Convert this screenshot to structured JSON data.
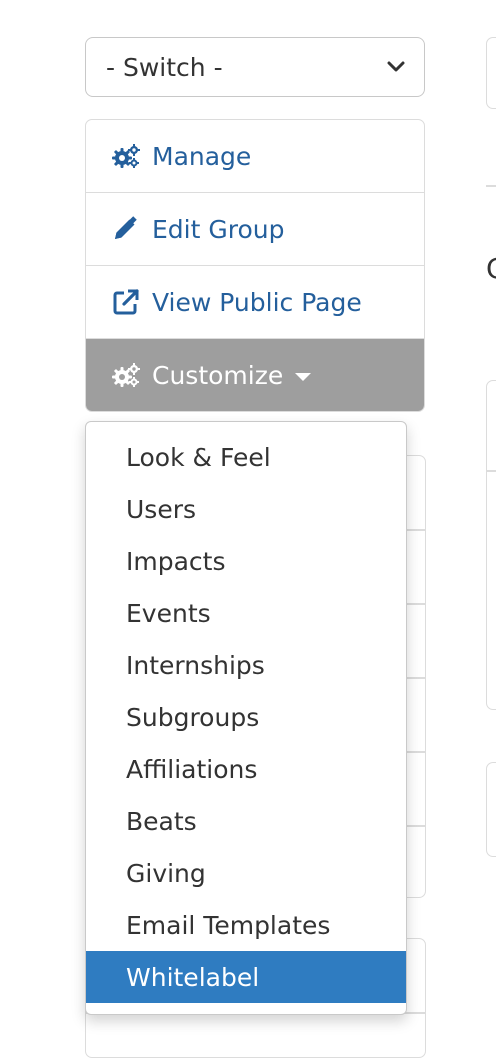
{
  "switch": {
    "value": "- Switch -"
  },
  "nav": {
    "items": [
      {
        "label": "Manage",
        "icon": "gears-icon"
      },
      {
        "label": "Edit Group",
        "icon": "pencil-icon"
      },
      {
        "label": "View Public Page",
        "icon": "external-link-icon"
      },
      {
        "label": "Customize",
        "icon": "gears-icon",
        "active": true
      }
    ]
  },
  "dropdown": {
    "items": [
      "Look & Feel",
      "Users",
      "Impacts",
      "Events",
      "Internships",
      "Subgroups",
      "Affiliations",
      "Beats",
      "Giving",
      "Email Templates",
      "Whitelabel"
    ],
    "highlighted": "Whitelabel"
  },
  "colors": {
    "link": "#245f9c",
    "active_nav_bg": "#9e9e9e",
    "highlight_bg": "#2f7cc1"
  }
}
